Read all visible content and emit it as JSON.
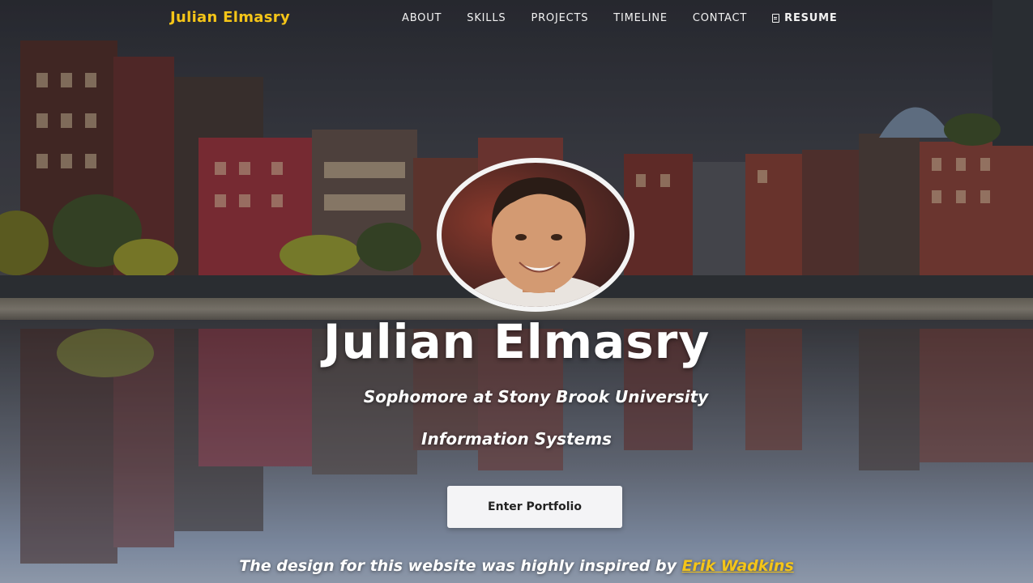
{
  "navbar": {
    "brand": "Julian Elmasry",
    "links": [
      "ABOUT",
      "SKILLS",
      "PROJECTS",
      "TIMELINE",
      "CONTACT"
    ],
    "resume_label": "RESUME",
    "resume_icon": "document-icon"
  },
  "hero": {
    "name": "Julian Elmasry",
    "subtitle": "Sophomore at Stony Brook University",
    "major": "Information Systems",
    "cta_label": "Enter Portfolio"
  },
  "footer": {
    "credit_text": "The design for this website was highly inspired by ",
    "credit_link": "Erik Wadkins"
  },
  "colors": {
    "accent": "#f5c518",
    "text": "#ffffff",
    "button_bg": "#f4f4f6"
  }
}
